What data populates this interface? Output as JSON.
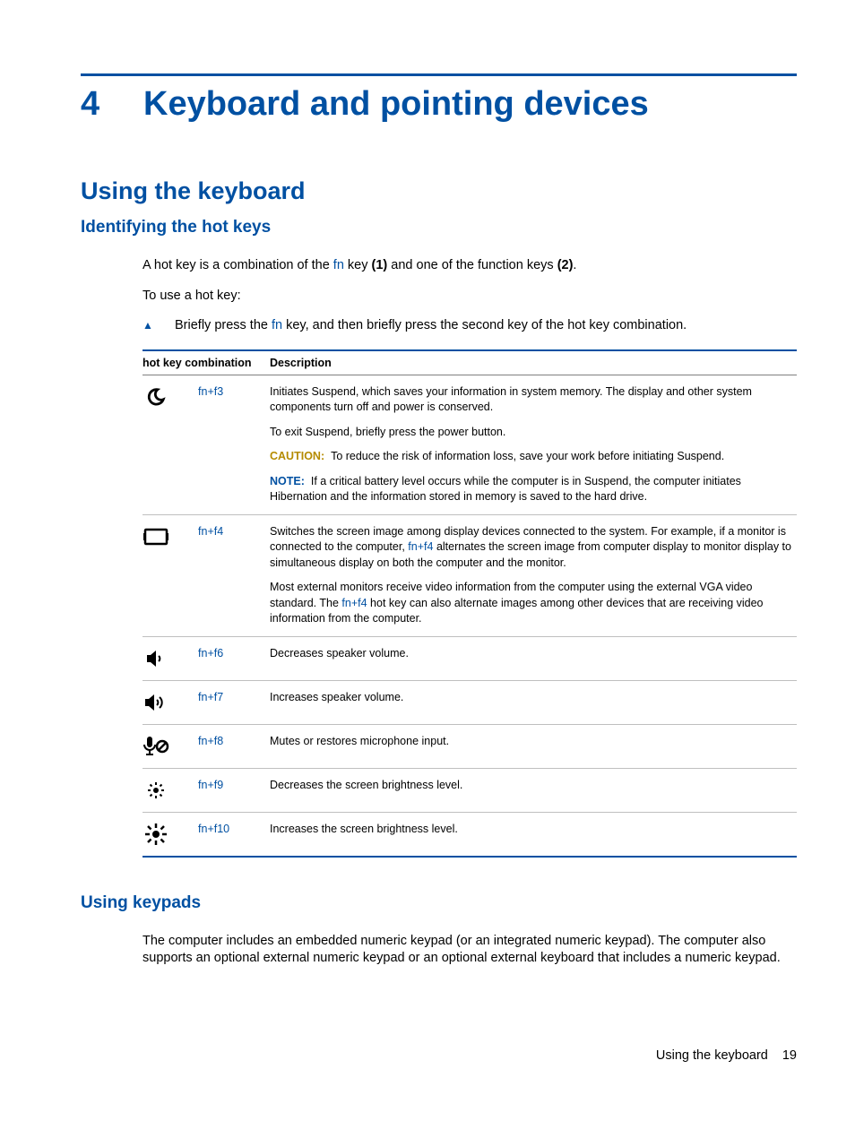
{
  "chapter": {
    "number": "4",
    "title": "Keyboard and pointing devices"
  },
  "section1": {
    "title": "Using the keyboard",
    "sub1": {
      "title": "Identifying the hot keys",
      "intro_pre": "A hot key is a combination of the ",
      "intro_fn": "fn",
      "intro_mid": " key ",
      "intro_bold1": "(1)",
      "intro_mid2": " and one of the function keys ",
      "intro_bold2": "(2)",
      "intro_end": ".",
      "howto": "To use a hot key:",
      "step_pre": "Briefly press the ",
      "step_fn": "fn",
      "step_post": " key, and then briefly press the second key of the hot key combination."
    }
  },
  "table": {
    "col1": "hot key combination",
    "col2": "Description",
    "rows": [
      {
        "key_fn": "fn",
        "key_plus": "+",
        "key_fx": "f3",
        "p1": "Initiates Suspend, which saves your information in system memory. The display and other system components turn off and power is conserved.",
        "p2": "To exit Suspend, briefly press the power button.",
        "caution_label": "CAUTION:",
        "caution_text": "To reduce the risk of information loss, save your work before initiating Suspend.",
        "note_label": "NOTE:",
        "note_text": "If a critical battery level occurs while the computer is in Suspend, the computer initiates Hibernation and the information stored in memory is saved to the hard drive."
      },
      {
        "key_fn": "fn",
        "key_plus": "+",
        "key_fx": "f4",
        "p1_pre": "Switches the screen image among display devices connected to the system. For example, if a monitor is connected to the computer, ",
        "p1_fn": "fn",
        "p1_plus": "+",
        "p1_fx": "f4",
        "p1_post": " alternates the screen image from computer display to monitor display to simultaneous display on both the computer and the monitor.",
        "p2_pre": "Most external monitors receive video information from the computer using the external VGA video standard. The ",
        "p2_fn": "fn",
        "p2_plus": "+",
        "p2_fx": "f4",
        "p2_post": " hot key can also alternate images among other devices that are receiving video information from the computer."
      },
      {
        "key_fn": "fn",
        "key_plus": "+",
        "key_fx": "f6",
        "p1": "Decreases speaker volume."
      },
      {
        "key_fn": "fn",
        "key_plus": "+",
        "key_fx": "f7",
        "p1": "Increases speaker volume."
      },
      {
        "key_fn": "fn",
        "key_plus": "+",
        "key_fx": "f8",
        "p1": "Mutes or restores microphone input."
      },
      {
        "key_fn": "fn",
        "key_plus": "+",
        "key_fx": "f9",
        "p1": "Decreases the screen brightness level."
      },
      {
        "key_fn": "fn",
        "key_plus": "+",
        "key_fx": "f10",
        "p1": "Increases the screen brightness level."
      }
    ]
  },
  "section2": {
    "title": "Using keypads",
    "para": "The computer includes an embedded numeric keypad (or an integrated numeric keypad). The computer also supports an optional external numeric keypad or an optional external keyboard that includes a numeric keypad."
  },
  "footer": {
    "text": "Using the keyboard",
    "page": "19"
  }
}
